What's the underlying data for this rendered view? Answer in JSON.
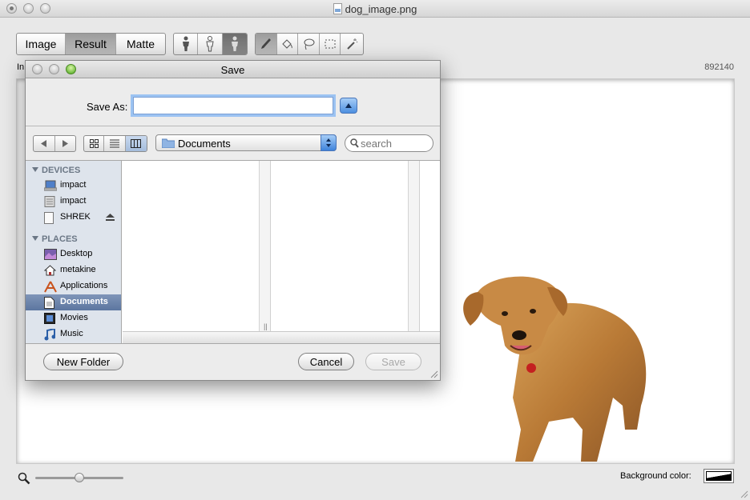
{
  "window": {
    "title": "dog_image.png",
    "image_info_prefix": "In",
    "image_info_right": "892140"
  },
  "toolbar": {
    "view_tabs": [
      {
        "label": "Image",
        "selected": false
      },
      {
        "label": "Result",
        "selected": true
      },
      {
        "label": "Matte",
        "selected": false
      }
    ],
    "tool_icons": [
      "foreground-figure-icon",
      "outline-figure-icon",
      "figure-selected-icon",
      "brush-icon",
      "paint-bucket-icon",
      "lasso-icon",
      "rect-select-icon",
      "magic-wand-icon"
    ]
  },
  "bottom": {
    "zoom_level": 0.5,
    "background_color_label": "Background color:"
  },
  "dialog": {
    "title": "Save",
    "save_as_label": "Save As:",
    "save_as_value": "",
    "location": "Documents",
    "search_placeholder": "search",
    "sidebar": {
      "devices_header": "DEVICES",
      "devices": [
        {
          "label": "impact",
          "icon": "laptop-icon"
        },
        {
          "label": "impact",
          "icon": "server-icon"
        },
        {
          "label": "SHREK",
          "icon": "disk-icon"
        }
      ],
      "places_header": "PLACES",
      "places": [
        {
          "label": "Desktop",
          "icon": "desktop-icon",
          "selected": false
        },
        {
          "label": "metakine",
          "icon": "home-icon",
          "selected": false
        },
        {
          "label": "Applications",
          "icon": "applications-icon",
          "selected": false
        },
        {
          "label": "Documents",
          "icon": "documents-icon",
          "selected": true
        },
        {
          "label": "Movies",
          "icon": "movies-icon",
          "selected": false
        },
        {
          "label": "Music",
          "icon": "music-icon",
          "selected": false
        }
      ]
    },
    "new_folder_label": "New Folder",
    "cancel_label": "Cancel",
    "save_label": "Save"
  },
  "colors": {
    "sidebar_selected": "#6a82ab",
    "focus_ring": "#9cc3f2",
    "accent_blue": "#4d8fe0"
  }
}
